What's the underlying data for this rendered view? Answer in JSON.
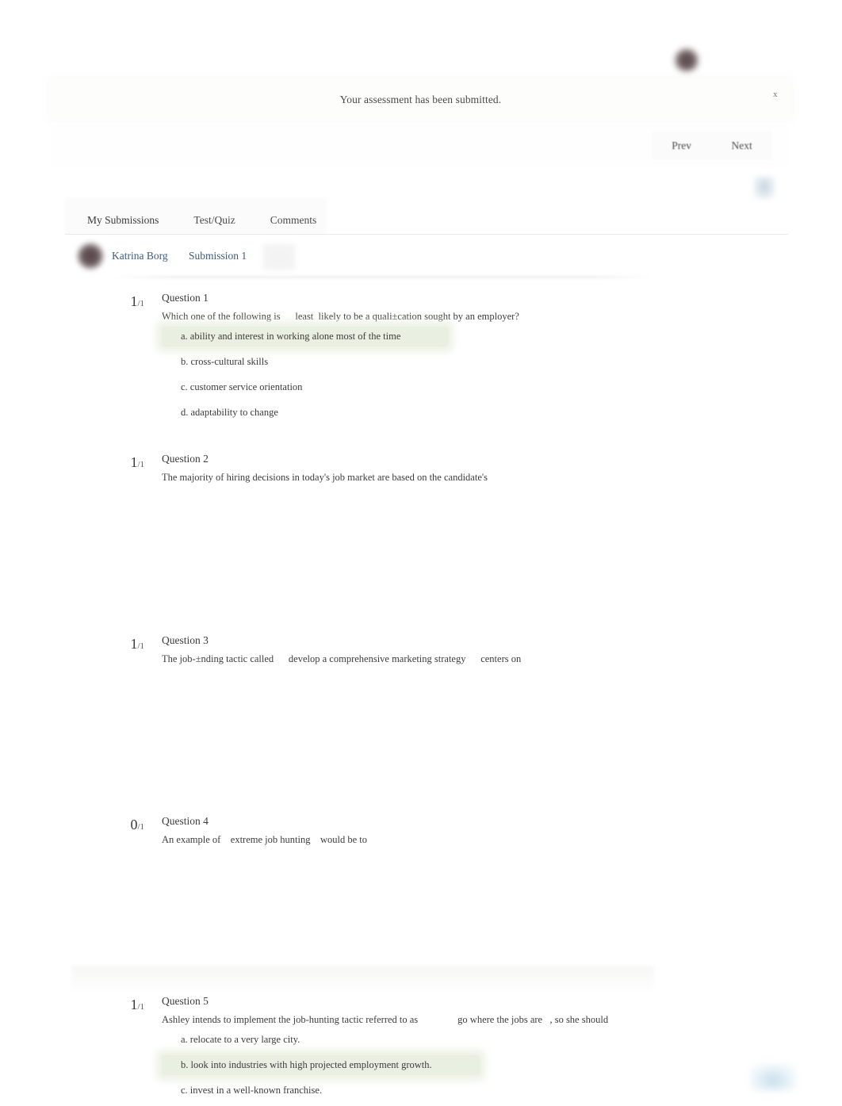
{
  "alert": {
    "message": "Your assessment has been submitted.",
    "close_label": "x"
  },
  "toolbar": {
    "prev_label": "Prev",
    "next_label": "Next"
  },
  "tabs": [
    {
      "label": "My Submissions",
      "active": true
    },
    {
      "label": "Test/Quiz",
      "active": false
    },
    {
      "label": "Comments",
      "active": false
    }
  ],
  "submission_header": {
    "user_name": "Katrina Borg",
    "submission_label": "Submission 1"
  },
  "questions": [
    {
      "score": "1",
      "score_total": "/1",
      "title": "Question 1",
      "text": "Which one of the following is      least  likely to be a quali±cation sought by an employer?",
      "options": [
        {
          "label": "a. ability and interest in working alone most of the time",
          "selected": true
        },
        {
          "label": "b. cross-cultural skills",
          "selected": false
        },
        {
          "label": "c. customer service orientation",
          "selected": false
        },
        {
          "label": "d. adaptability to change",
          "selected": false
        }
      ]
    },
    {
      "score": "1",
      "score_total": "/1",
      "title": "Question 2",
      "text": "The majority of hiring decisions in today's job market are based on the candidate's",
      "options": []
    },
    {
      "score": "1",
      "score_total": "/1",
      "title": "Question 3",
      "text": "The job-±nding tactic called      develop a comprehensive marketing strategy      centers on",
      "options": []
    },
    {
      "score": "0",
      "score_total": "/1",
      "title": "Question 4",
      "text": "An example of    extreme job hunting    would be to",
      "options": []
    },
    {
      "score": "1",
      "score_total": "/1",
      "title": "Question 5",
      "text": "Ashley intends to implement the job-hunting tactic referred to as                go where the jobs are   , so she should",
      "options": [
        {
          "label": "a. relocate to a very large city.",
          "selected": false
        },
        {
          "label": "b. look into industries with high projected employment growth.",
          "selected": true
        },
        {
          "label": "c. invest in a well-known franchise.",
          "selected": false
        }
      ]
    }
  ],
  "colors": {
    "link": "#3d5a80",
    "selected_highlight": "#eaf0e1",
    "text": "#3b3b3b"
  }
}
